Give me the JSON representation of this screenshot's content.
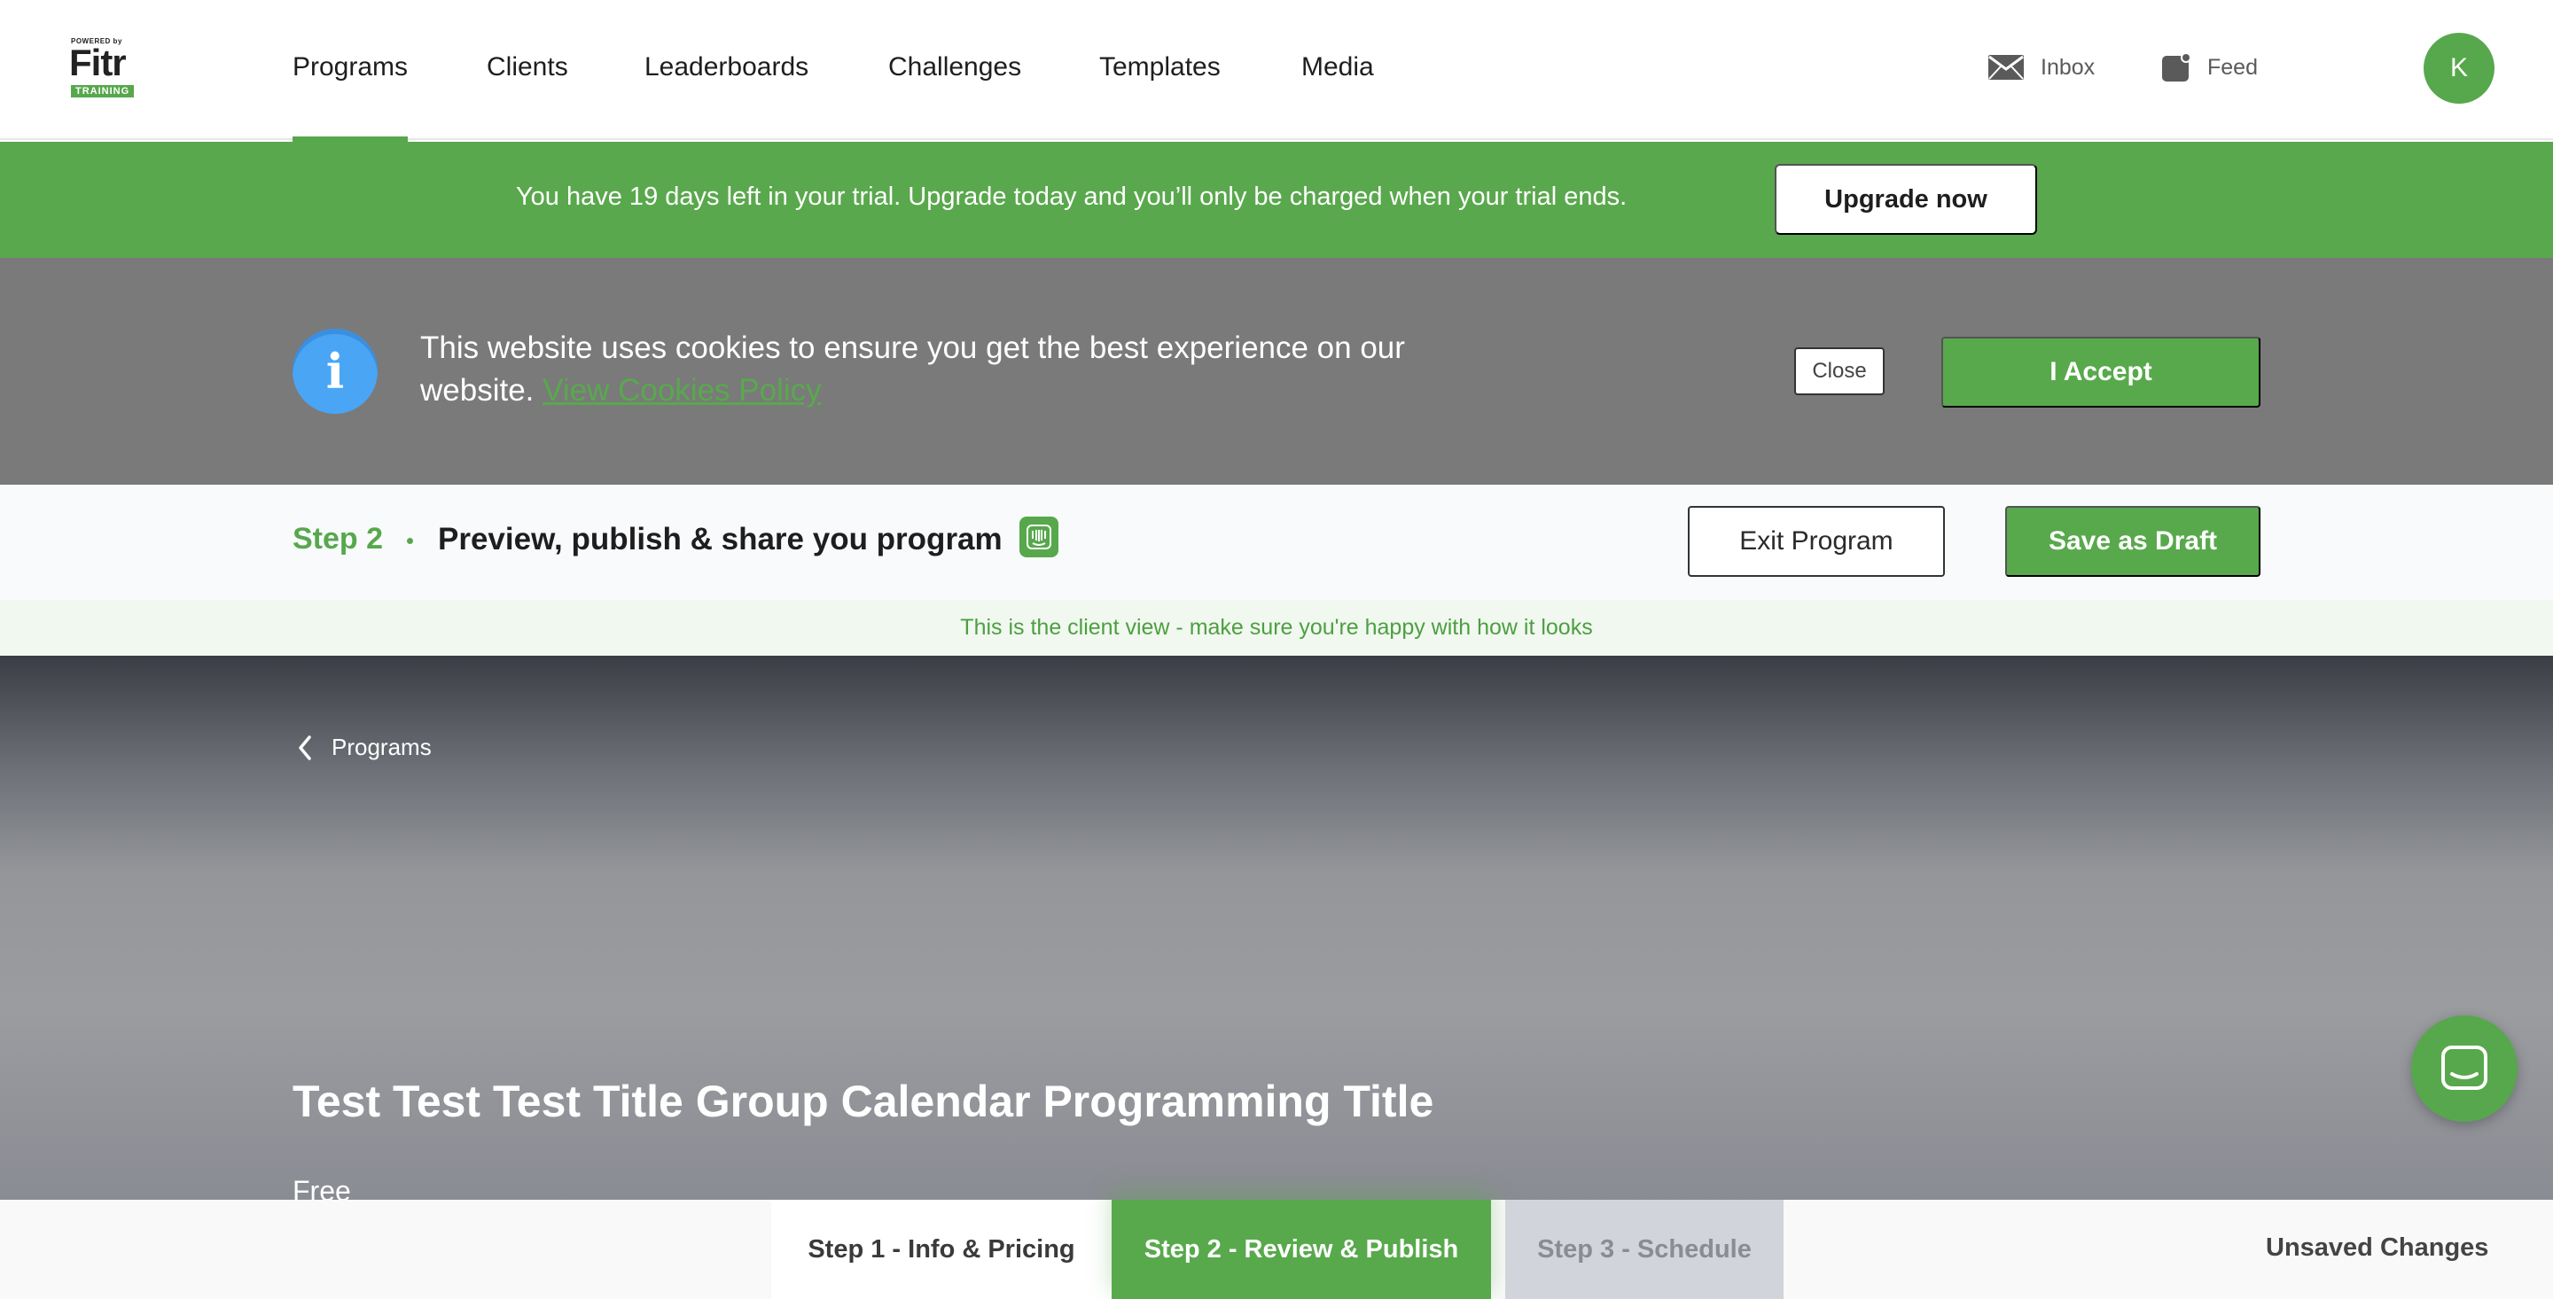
{
  "nav": {
    "logo": {
      "powered": "POWERED by",
      "word": "Fitr",
      "badge": "TRAINING"
    },
    "items": [
      {
        "label": "Programs",
        "active": true
      },
      {
        "label": "Clients"
      },
      {
        "label": "Leaderboards"
      },
      {
        "label": "Challenges"
      },
      {
        "label": "Templates"
      },
      {
        "label": "Media"
      }
    ],
    "inbox_label": "Inbox",
    "feed_label": "Feed",
    "avatar_initial": "K"
  },
  "trial_banner": {
    "text": "You have 19 days left in your trial. Upgrade today and you’ll only be charged when your trial ends.",
    "upgrade_label": "Upgrade now"
  },
  "cookie_banner": {
    "text": "This website uses cookies to ensure you get the best experience on our website.",
    "link": "View Cookies Policy",
    "close_label": "Close",
    "accept_label": "I Accept"
  },
  "step_header": {
    "step": "Step 2",
    "title": "Preview, publish & share you program",
    "exit_label": "Exit Program",
    "draft_label": "Save as Draft",
    "client_view_note": "This is the client view - make sure you're happy with how it looks"
  },
  "hero": {
    "back_label": "Programs",
    "title": "Test Test Test Title Group Calendar Programming Title",
    "price": "Free"
  },
  "wizard": {
    "steps": [
      {
        "label": "Step 1 - Info & Pricing",
        "state": "complete"
      },
      {
        "label": "Step 2 - Review & Publish",
        "state": "active"
      },
      {
        "label": "Step 3 - Schedule",
        "state": "disabled"
      }
    ],
    "status": "Unsaved Changes"
  },
  "colors": {
    "brand_green": "#57a84c",
    "cookie_grey": "#7a7a7a",
    "info_blue": "#4aa5f5"
  }
}
